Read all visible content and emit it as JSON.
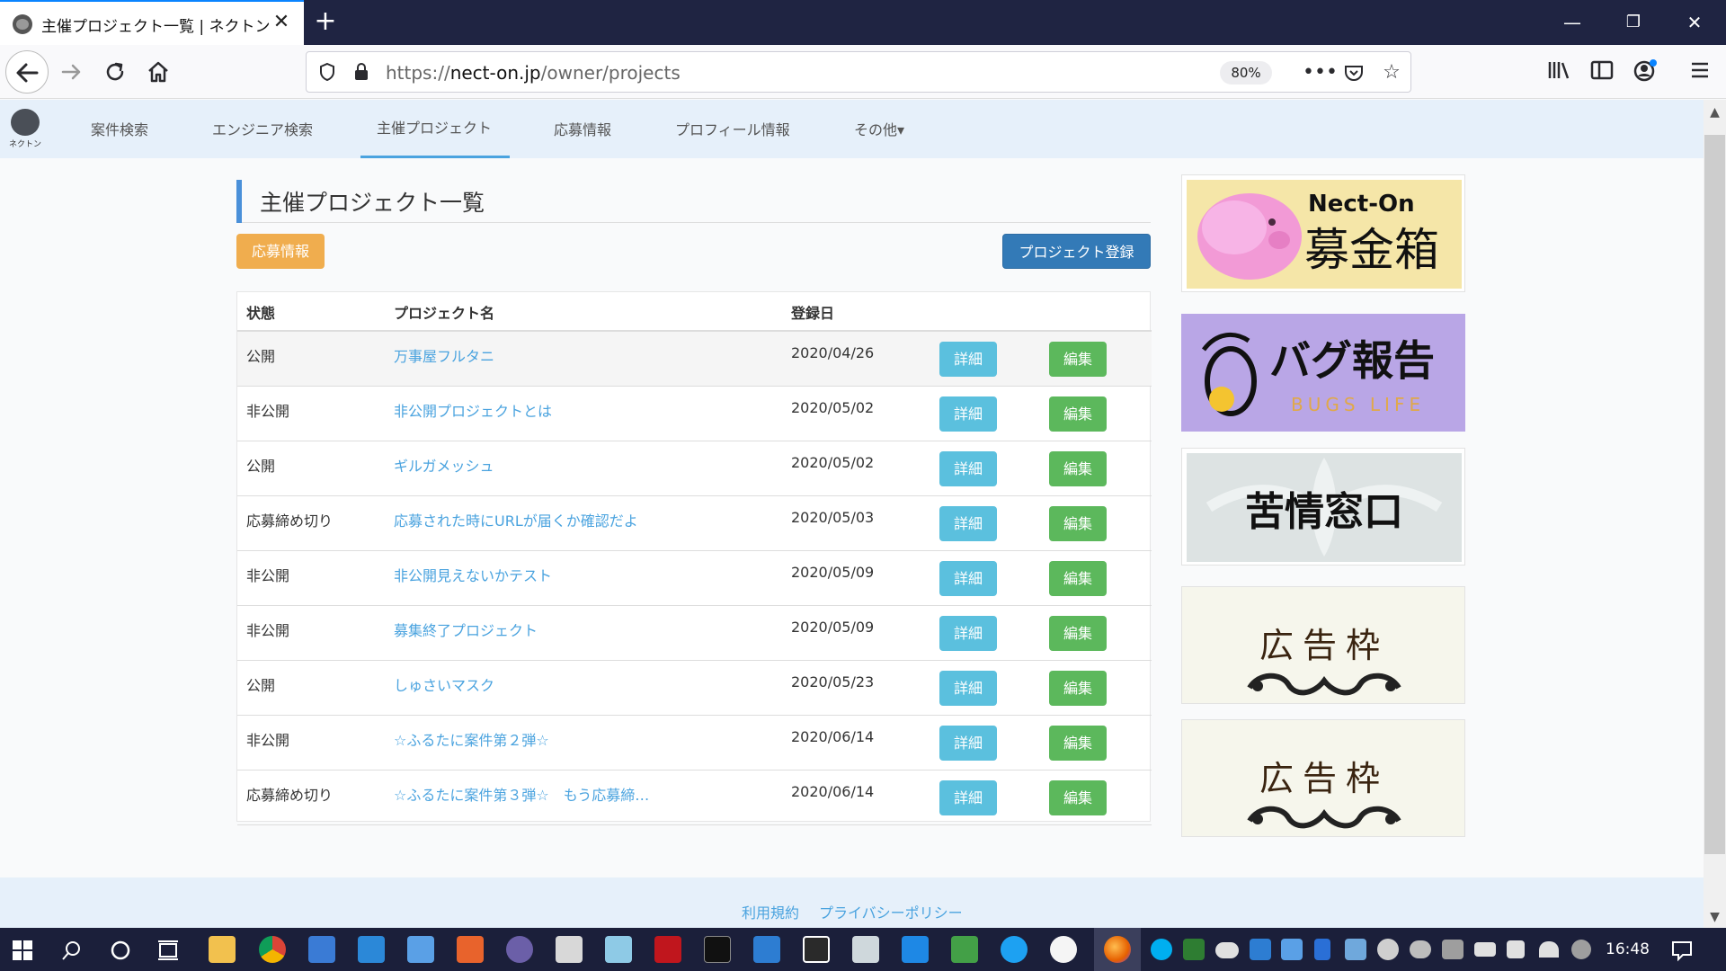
{
  "browser": {
    "tab_title": "主催プロジェクト一覧 | ネクトン",
    "tab_close": "✕",
    "new_tab": "+",
    "url_scheme": "https://",
    "url_host": "nect-on.jp",
    "url_path": "/owner/projects",
    "zoom": "80%",
    "window_min": "—",
    "window_restore": "❐",
    "window_close": "✕",
    "icons": {
      "back": "arrow-left-icon",
      "forward": "arrow-right-icon",
      "reload": "reload-icon",
      "home": "home-icon",
      "more": "more-icon",
      "pocket": "pocket-icon",
      "bookmark": "star-icon",
      "library": "library-icon",
      "sidebar": "sidebar-icon",
      "account": "account-icon",
      "menu": "hamburger-menu-icon"
    }
  },
  "site": {
    "logo_label": "ネクトン",
    "nav": [
      {
        "label": "案件検索"
      },
      {
        "label": "エンジニア検索"
      },
      {
        "label": "主催プロジェクト"
      },
      {
        "label": "応募情報"
      },
      {
        "label": "プロフィール情報"
      },
      {
        "label": "その他▾"
      }
    ],
    "page_title": "主催プロジェクト一覧",
    "apply_button": "応募情報",
    "register_button": "プロジェクト登録",
    "table": {
      "headers": [
        "状態",
        "プロジェクト名",
        "登録日"
      ],
      "rows": [
        {
          "status": "公開",
          "name": "万事屋フルタニ",
          "date": "2020/04/26"
        },
        {
          "status": "非公開",
          "name": "非公開プロジェクトとは",
          "date": "2020/05/02"
        },
        {
          "status": "公開",
          "name": "ギルガメッシュ",
          "date": "2020/05/02"
        },
        {
          "status": "応募締め切り",
          "name": "応募された時にURLが届くか確認だよ",
          "date": "2020/05/03"
        },
        {
          "status": "非公開",
          "name": "非公開見えないかテスト",
          "date": "2020/05/09"
        },
        {
          "status": "非公開",
          "name": "募集終了プロジェクト",
          "date": "2020/05/09"
        },
        {
          "status": "公開",
          "name": "しゅさいマスク",
          "date": "2020/05/23"
        },
        {
          "status": "非公開",
          "name": "☆ふるたに案件第２弾☆",
          "date": "2020/06/14"
        },
        {
          "status": "応募締め切り",
          "name": "☆ふるたに案件第３弾☆　もう応募締…",
          "date": "2020/06/14"
        }
      ],
      "detail_label": "詳細",
      "edit_label": "編集"
    },
    "banners": [
      {
        "title": "Nect-On",
        "subtitle": "募金箱"
      },
      {
        "title": "バグ報告",
        "subtitle": "BUGS LIFE"
      },
      {
        "title": "苦情窓口"
      },
      {
        "title": "広告枠"
      },
      {
        "title": "広告枠"
      }
    ],
    "footer": {
      "terms": "利用規約",
      "privacy": "プライバシーポリシー"
    }
  },
  "taskbar": {
    "clock": "16:48"
  }
}
